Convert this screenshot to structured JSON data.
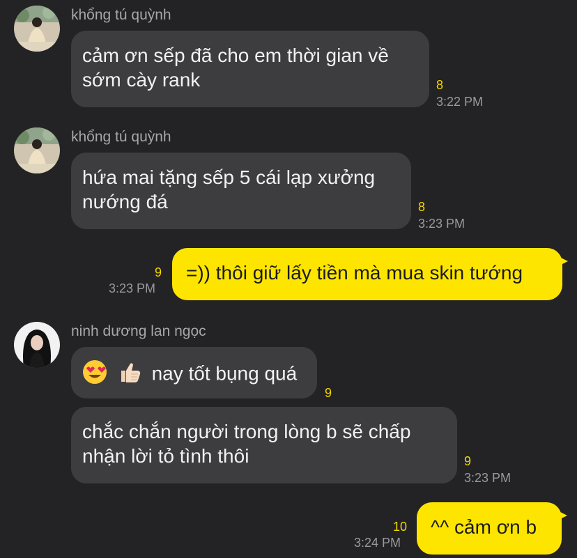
{
  "messages": [
    {
      "sender": "khổng tú quỳnh",
      "text": "cảm ơn sếp đã cho em thời gian về sớm cày rank",
      "unread": "8",
      "time": "3:22 PM"
    },
    {
      "sender": "khổng tú quỳnh",
      "text": "hứa mai tặng sếp 5 cái lạp xưởng nướng đá",
      "unread": "8",
      "time": "3:23 PM"
    },
    {
      "sender": "",
      "text": "=)) thôi giữ lấy tiền mà mua skin tướng",
      "unread": "9",
      "time": "3:23 PM"
    },
    {
      "sender": "ninh dương lan ngọc",
      "text": "nay tốt bụng quá",
      "unread": "9",
      "time": "",
      "emojis": [
        "heart-eyes-emoji",
        "thumbs-up-emoji"
      ]
    },
    {
      "sender": "",
      "text": "chắc chắn người trong lòng b sẽ chấp nhận lời tỏ tình thôi",
      "unread": "9",
      "time": "3:23 PM"
    },
    {
      "sender": "",
      "text": "^^ cảm ơn b",
      "unread": "10",
      "time": "3:24 PM"
    }
  ]
}
